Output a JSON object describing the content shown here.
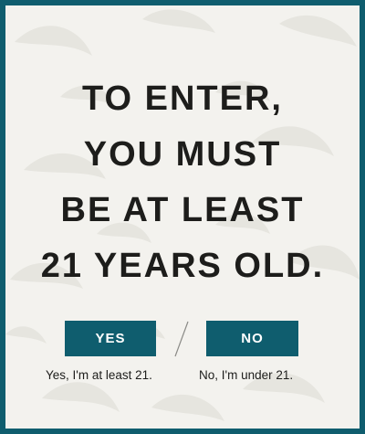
{
  "gate": {
    "headline_lines": [
      "TO ENTER,",
      "YOU MUST",
      "BE AT LEAST",
      "21 YEARS OLD."
    ],
    "yes_label": "YES",
    "no_label": "NO",
    "divider": "/",
    "yes_caption": "Yes, I'm at least 21.",
    "no_caption": "No, I'm under 21."
  },
  "colors": {
    "frame": "#0f5d6e",
    "button": "#0f5d6e",
    "panel": "#f3f2ee",
    "text": "#1d1d1b"
  }
}
